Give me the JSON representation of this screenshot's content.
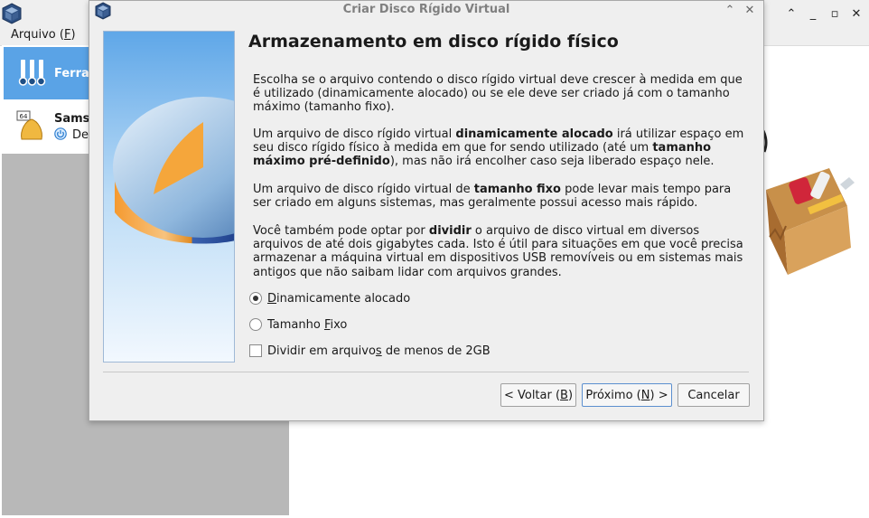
{
  "main_window": {
    "menu": {
      "file_pre": "Arquivo (",
      "file_key": "F",
      "file_post": ")"
    },
    "sidebar": {
      "tools_label": "Ferra",
      "vm": {
        "name": "Sams",
        "state": "Des",
        "badge": "64"
      }
    },
    "controls": {
      "collapse": "⌃",
      "minimize": "_",
      "maximize": "▫",
      "close": "✕"
    }
  },
  "dialog": {
    "title": "Criar Disco Rígido Virtual",
    "controls": {
      "collapse": "⌃",
      "close": "✕"
    },
    "heading": "Armazenamento em disco rígido físico",
    "para1": "Escolha se o arquivo contendo o disco rígido virtual deve crescer à medida em que é utilizado (dinamicamente alocado) ou se ele deve ser criado já com o tamanho máximo (tamanho fixo).",
    "para2": {
      "t1": "Um arquivo de disco rígido virtual ",
      "b1": "dinamicamente alocado",
      "t2": " irá utilizar espaço em seu disco rígido físico à medida em que for sendo utilizado (até um ",
      "b2": "tamanho máximo pré-definido",
      "t3": "), mas não irá encolher caso seja liberado espaço nele."
    },
    "para3": {
      "t1": "Um arquivo de disco rígido virtual de ",
      "b1": "tamanho fixo",
      "t2": " pode levar mais tempo para ser criado em alguns sistemas, mas geralmente possui acesso mais rápido."
    },
    "para4": {
      "t1": "Você também pode optar por ",
      "b1": "dividir",
      "t2": " o arquivo de disco virtual em diversos arquivos de até dois gigabytes cada. Isto é útil para situações em que você precisa armazenar a máquina virtual em dispositivos USB removíveis ou em sistemas mais antigos que não saibam lidar com arquivos grandes."
    },
    "options": {
      "dynamic": {
        "key": "D",
        "rest": "inamicamente alocado",
        "selected": true
      },
      "fixed": {
        "pre": "Tamanho ",
        "key": "F",
        "rest": "ixo",
        "selected": false
      },
      "split": {
        "pre": "Dividir em arquivo",
        "key": "s",
        "rest": " de menos de 2GB",
        "checked": false
      }
    },
    "buttons": {
      "back": {
        "pre": "< Voltar (",
        "key": "B",
        "post": ")"
      },
      "next": {
        "pre": "Próximo (",
        "key": "N",
        "post": ") >"
      },
      "cancel": "Cancelar"
    }
  }
}
